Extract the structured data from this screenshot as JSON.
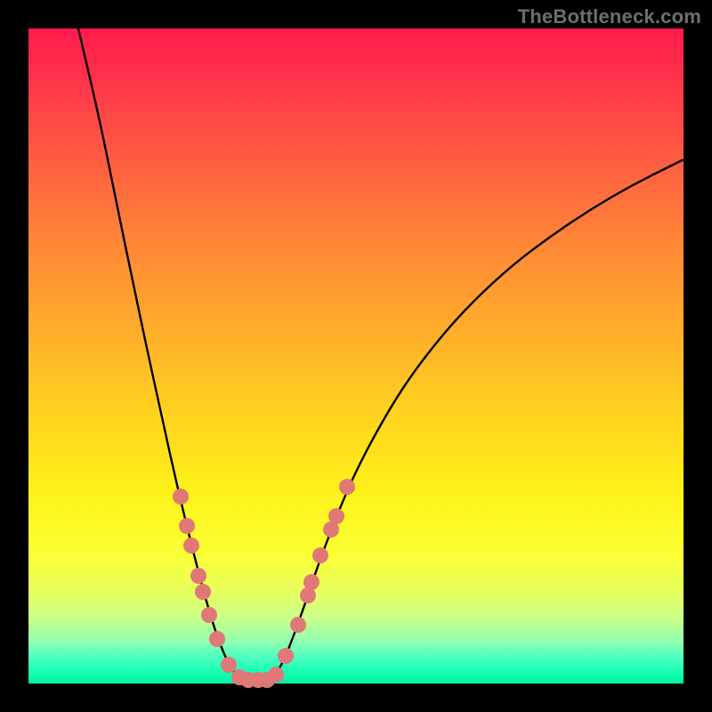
{
  "watermark": "TheBottleneck.com",
  "colors": {
    "frame": "#000000",
    "curve": "#000000",
    "marker": "#e07878",
    "gradient_top": "#ff1a4d",
    "gradient_bottom": "#00f5a0"
  },
  "chart_data": {
    "type": "line",
    "title": "",
    "xlabel": "",
    "ylabel": "",
    "xlim": [
      0,
      100
    ],
    "ylim": [
      0,
      100
    ],
    "curve": {
      "left_branch": [
        {
          "x": 7.6,
          "y": 100.0
        },
        {
          "x": 9.5,
          "y": 92.0
        },
        {
          "x": 11.5,
          "y": 83.0
        },
        {
          "x": 13.5,
          "y": 73.0
        },
        {
          "x": 15.8,
          "y": 62.0
        },
        {
          "x": 18.0,
          "y": 51.5
        },
        {
          "x": 20.3,
          "y": 41.0
        },
        {
          "x": 22.5,
          "y": 31.0
        },
        {
          "x": 24.8,
          "y": 21.5
        },
        {
          "x": 27.0,
          "y": 13.0
        },
        {
          "x": 29.0,
          "y": 6.5
        },
        {
          "x": 31.0,
          "y": 2.0
        },
        {
          "x": 33.0,
          "y": 0.5
        }
      ],
      "valley": [
        {
          "x": 33.0,
          "y": 0.5
        },
        {
          "x": 35.0,
          "y": 0.5
        },
        {
          "x": 37.0,
          "y": 0.5
        }
      ],
      "right_branch": [
        {
          "x": 37.0,
          "y": 0.5
        },
        {
          "x": 38.5,
          "y": 2.5
        },
        {
          "x": 40.0,
          "y": 6.0
        },
        {
          "x": 42.0,
          "y": 11.5
        },
        {
          "x": 44.0,
          "y": 17.5
        },
        {
          "x": 47.0,
          "y": 25.5
        },
        {
          "x": 50.0,
          "y": 32.5
        },
        {
          "x": 54.0,
          "y": 40.0
        },
        {
          "x": 58.0,
          "y": 46.5
        },
        {
          "x": 63.0,
          "y": 53.0
        },
        {
          "x": 68.0,
          "y": 58.5
        },
        {
          "x": 74.0,
          "y": 64.0
        },
        {
          "x": 80.0,
          "y": 68.5
        },
        {
          "x": 86.0,
          "y": 72.5
        },
        {
          "x": 92.0,
          "y": 76.0
        },
        {
          "x": 98.0,
          "y": 79.0
        },
        {
          "x": 100.0,
          "y": 80.0
        }
      ]
    },
    "markers": [
      {
        "x": 23.2,
        "y": 28.5
      },
      {
        "x": 24.2,
        "y": 24.0
      },
      {
        "x": 24.8,
        "y": 21.0
      },
      {
        "x": 26.0,
        "y": 16.5
      },
      {
        "x": 26.6,
        "y": 14.0
      },
      {
        "x": 27.6,
        "y": 10.5
      },
      {
        "x": 28.8,
        "y": 6.8
      },
      {
        "x": 30.6,
        "y": 2.8
      },
      {
        "x": 32.2,
        "y": 0.9
      },
      {
        "x": 33.6,
        "y": 0.5
      },
      {
        "x": 35.0,
        "y": 0.5
      },
      {
        "x": 36.4,
        "y": 0.5
      },
      {
        "x": 37.8,
        "y": 1.4
      },
      {
        "x": 39.2,
        "y": 4.2
      },
      {
        "x": 41.2,
        "y": 9.0
      },
      {
        "x": 42.6,
        "y": 13.5
      },
      {
        "x": 43.2,
        "y": 15.5
      },
      {
        "x": 44.6,
        "y": 19.5
      },
      {
        "x": 46.2,
        "y": 23.5
      },
      {
        "x": 47.0,
        "y": 25.5
      },
      {
        "x": 48.6,
        "y": 30.0
      }
    ]
  }
}
